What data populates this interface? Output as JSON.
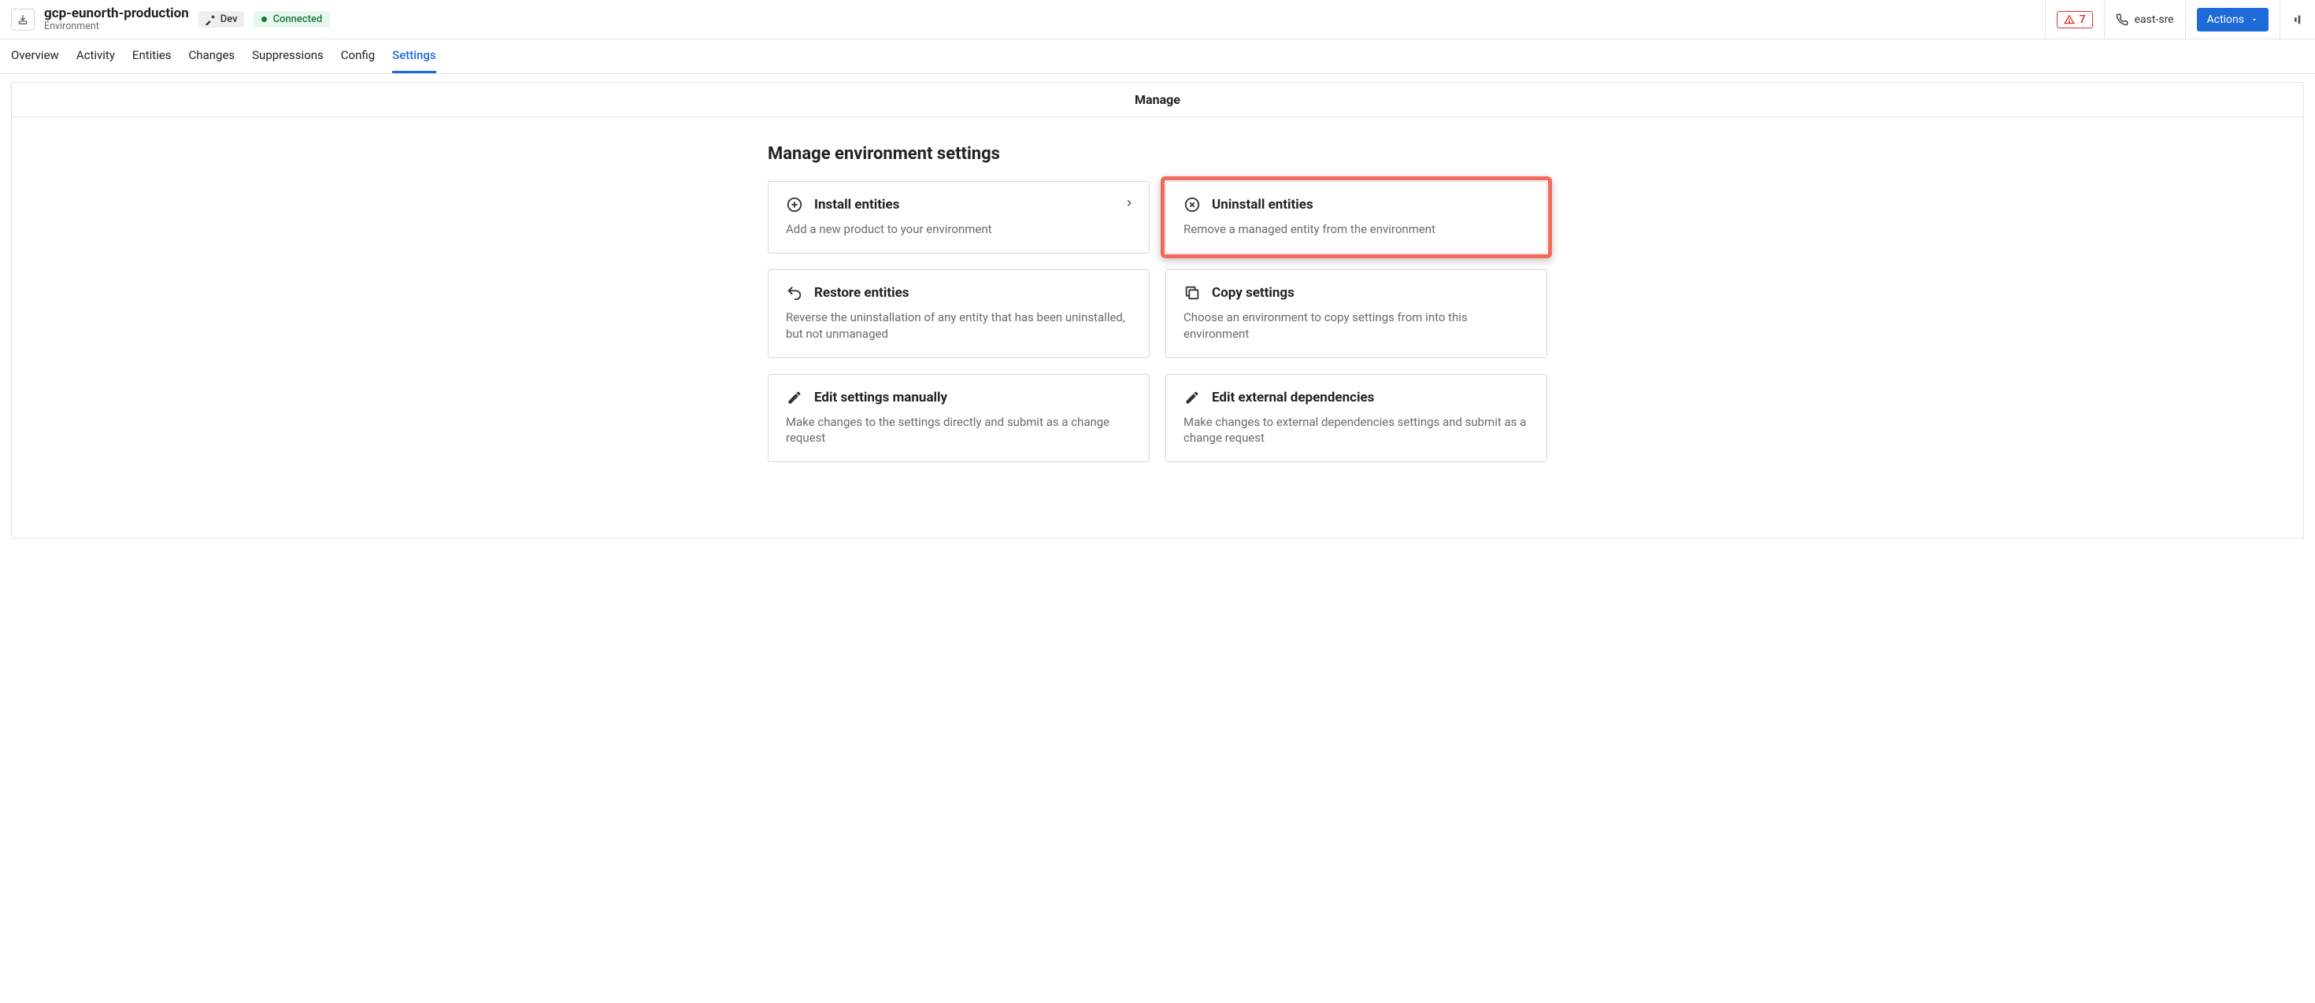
{
  "header": {
    "title": "gcp-eunorth-production",
    "subtitle": "Environment",
    "dev_label": "Dev",
    "conn_label": "Connected",
    "alert_count": "7",
    "contact_label": "east-sre",
    "actions_label": "Actions"
  },
  "tabs": [
    {
      "label": "Overview",
      "active": false
    },
    {
      "label": "Activity",
      "active": false
    },
    {
      "label": "Entities",
      "active": false
    },
    {
      "label": "Changes",
      "active": false
    },
    {
      "label": "Suppressions",
      "active": false
    },
    {
      "label": "Config",
      "active": false
    },
    {
      "label": "Settings",
      "active": true
    }
  ],
  "panel_title": "Manage",
  "section_heading": "Manage environment settings",
  "cards": {
    "install": {
      "title": "Install entities",
      "desc": "Add a new product to your environment"
    },
    "uninstall": {
      "title": "Uninstall entities",
      "desc": "Remove a managed entity from the environment"
    },
    "restore": {
      "title": "Restore entities",
      "desc": "Reverse the uninstallation of any entity that has been uninstalled, but not unmanaged"
    },
    "copy": {
      "title": "Copy settings",
      "desc": "Choose an environment to copy settings from into this environment"
    },
    "edit": {
      "title": "Edit settings manually",
      "desc": "Make changes to the settings directly and submit as a change request"
    },
    "extdep": {
      "title": "Edit external dependencies",
      "desc": "Make changes to external dependencies settings and submit as a change request"
    }
  }
}
